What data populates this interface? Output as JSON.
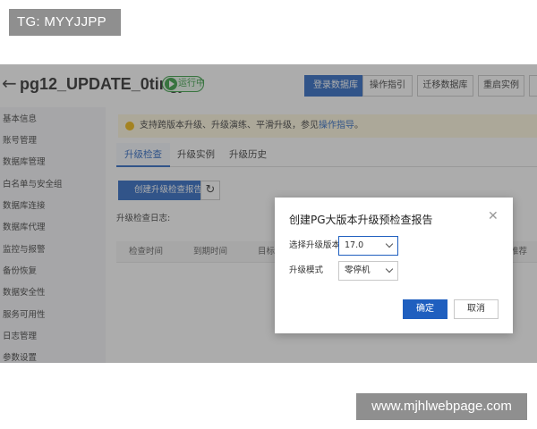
{
  "watermarks": {
    "top_left": "TG: MYYJJPP",
    "bottom_right": "www.mjhlwebpage.com"
  },
  "header": {
    "back_icon": "arrow-left-icon",
    "instance_name": "pg12_UPDATE_0tingji",
    "status": "运行中",
    "buttons": [
      "登录数据库",
      "操作指引",
      "迁移数据库",
      "重启实例"
    ]
  },
  "sidebar": {
    "items": [
      "基本信息",
      "账号管理",
      "数据库管理",
      "白名单与安全组",
      "数据库连接",
      "数据库代理",
      "监控与报警",
      "备份恢复",
      "数据安全性",
      "服务可用性",
      "日志管理",
      "参数设置"
    ]
  },
  "notice": {
    "text": "支持跨版本升级、升级演练、平滑升级，参见",
    "link": "操作指导",
    "suffix": "。"
  },
  "tabs": [
    "升级检查",
    "升级实例",
    "升级历史"
  ],
  "toolbar": {
    "create_label": "创建升级检查报告",
    "refresh_icon": "refresh-icon"
  },
  "log_label": "升级检查日志:",
  "table": {
    "headers": [
      "检查时间",
      "到期时间",
      "目标",
      "推荐"
    ]
  },
  "dialog": {
    "title": "创建PG大版本升级预检查报告",
    "close_icon": "close-icon",
    "version_label": "选择升级版本:",
    "version_value": "17.0",
    "mode_label": "升级模式",
    "mode_value": "零停机",
    "ok_label": "确定",
    "cancel_label": "取消"
  },
  "colors": {
    "primary": "#1f5fbf",
    "status_green": "#2c9a3a",
    "notice_bg": "#fff7dd"
  }
}
